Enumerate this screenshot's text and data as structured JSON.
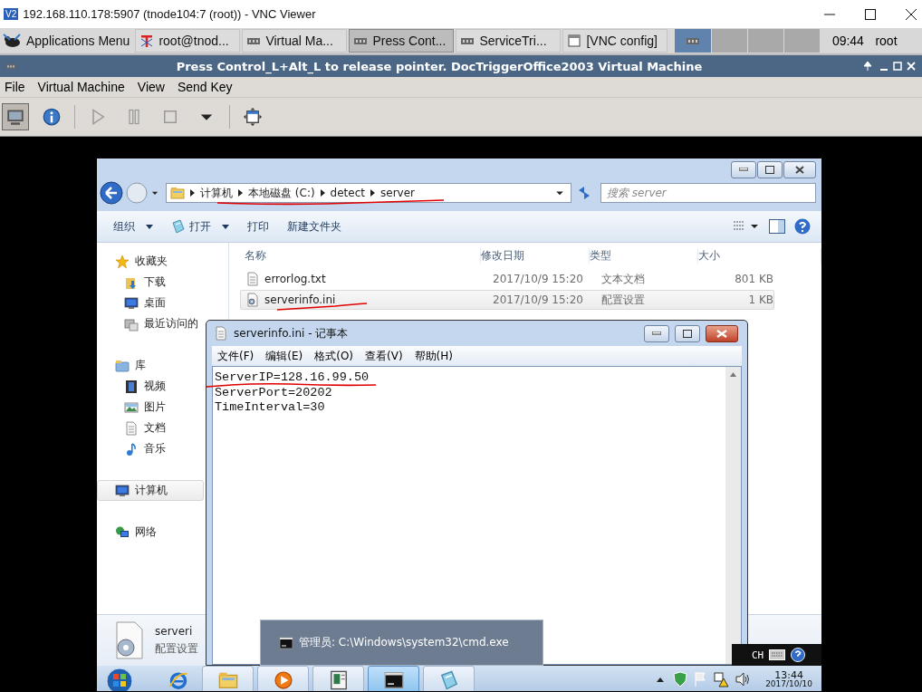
{
  "vnc_window": {
    "icon_text": "V2",
    "title": "192.168.110.178:5907 (tnode104:7 (root)) - VNC Viewer"
  },
  "panel": {
    "apps_menu": "Applications Menu",
    "tasks": [
      {
        "label": "root@tnod...",
        "kind": "terminal",
        "selected": false
      },
      {
        "label": "Virtual Ma...",
        "kind": "vm",
        "selected": false
      },
      {
        "label": "Press Cont...",
        "kind": "vm",
        "selected": true
      },
      {
        "label": "ServiceTri...",
        "kind": "vm",
        "selected": false
      },
      {
        "label": "[VNC config]",
        "kind": "window",
        "selected": false
      }
    ],
    "workspaces": [
      {
        "selected": true
      },
      {
        "selected": false
      },
      {
        "selected": false
      },
      {
        "selected": false
      }
    ],
    "clock": "09:44",
    "user": "root"
  },
  "vm_window": {
    "title": "Press Control_L+Alt_L to release pointer. DocTriggerOffice2003 Virtual Machine",
    "menu": [
      "File",
      "Virtual Machine",
      "View",
      "Send Key"
    ],
    "toolbar": [
      {
        "kind": "console",
        "selected": true
      },
      {
        "kind": "info",
        "selected": false
      },
      {
        "kind": "separator"
      },
      {
        "kind": "play",
        "selected": false
      },
      {
        "kind": "pause",
        "selected": false
      },
      {
        "kind": "stop",
        "selected": false
      },
      {
        "kind": "caret",
        "selected": false
      },
      {
        "kind": "separator"
      },
      {
        "kind": "fullscreen",
        "selected": false
      }
    ]
  },
  "explorer": {
    "breadcrumb": [
      "计算机",
      "本地磁盘 (C:)",
      "detect",
      "server"
    ],
    "search": {
      "placeholder": "搜索 server"
    },
    "commands": [
      {
        "label": "组织",
        "kind": "plain",
        "dropdown": true
      },
      {
        "label": "打开",
        "kind": "open",
        "dropdown": true
      },
      {
        "label": "打印",
        "kind": "plain",
        "dropdown": false
      },
      {
        "label": "新建文件夹",
        "kind": "plain",
        "dropdown": false
      }
    ],
    "columns": [
      "名称",
      "修改日期",
      "类型",
      "大小"
    ],
    "nav": [
      {
        "label": "收藏夹",
        "kind": "star",
        "selected": false,
        "children": [
          {
            "label": "下载",
            "kind": "download",
            "selected": false
          },
          {
            "label": "桌面",
            "kind": "desktop",
            "selected": false
          },
          {
            "label": "最近访问的",
            "kind": "recent",
            "selected": false
          }
        ]
      },
      {
        "label": "库",
        "kind": "library",
        "selected": false,
        "children": [
          {
            "label": "视频",
            "kind": "video",
            "selected": false
          },
          {
            "label": "图片",
            "kind": "pictures",
            "selected": false
          },
          {
            "label": "文档",
            "kind": "docs",
            "selected": false
          },
          {
            "label": "音乐",
            "kind": "music",
            "selected": false
          }
        ]
      },
      {
        "label": "计算机",
        "kind": "computer",
        "selected": true
      },
      {
        "label": "网络",
        "kind": "network",
        "selected": false
      }
    ],
    "files": [
      {
        "name": "errorlog.txt",
        "kind": "text",
        "date": "2017/10/9 15:20",
        "type": "文本文档",
        "size": "801 KB",
        "selected": false
      },
      {
        "name": "serverinfo.ini",
        "kind": "config",
        "date": "2017/10/9 15:20",
        "type": "配置设置",
        "size": "1 KB",
        "selected": true
      }
    ],
    "details": {
      "name": "serveri",
      "type": "配置设置"
    }
  },
  "notepad": {
    "title": "serverinfo.ini - 记事本",
    "menu": [
      "文件(F)",
      "编辑(E)",
      "格式(O)",
      "查看(V)",
      "帮助(H)"
    ],
    "lines": [
      "ServerIP=128.16.99.50",
      "ServerPort=20202",
      "TimeInterval=30"
    ]
  },
  "thumbnail": {
    "label": "管理员: C:\\Windows\\system32\\cmd.exe"
  },
  "language_bar": {
    "label": "CH"
  },
  "taskbar": {
    "items": [
      {
        "kind": "ie",
        "selected": false
      },
      {
        "kind": "explorer",
        "selected": false
      },
      {
        "kind": "media",
        "selected": false
      },
      {
        "kind": "app",
        "selected": false
      },
      {
        "kind": "cmd",
        "selected": true
      },
      {
        "kind": "notepad",
        "selected": false
      }
    ],
    "time": "13:44",
    "date": "2017/10/10"
  }
}
